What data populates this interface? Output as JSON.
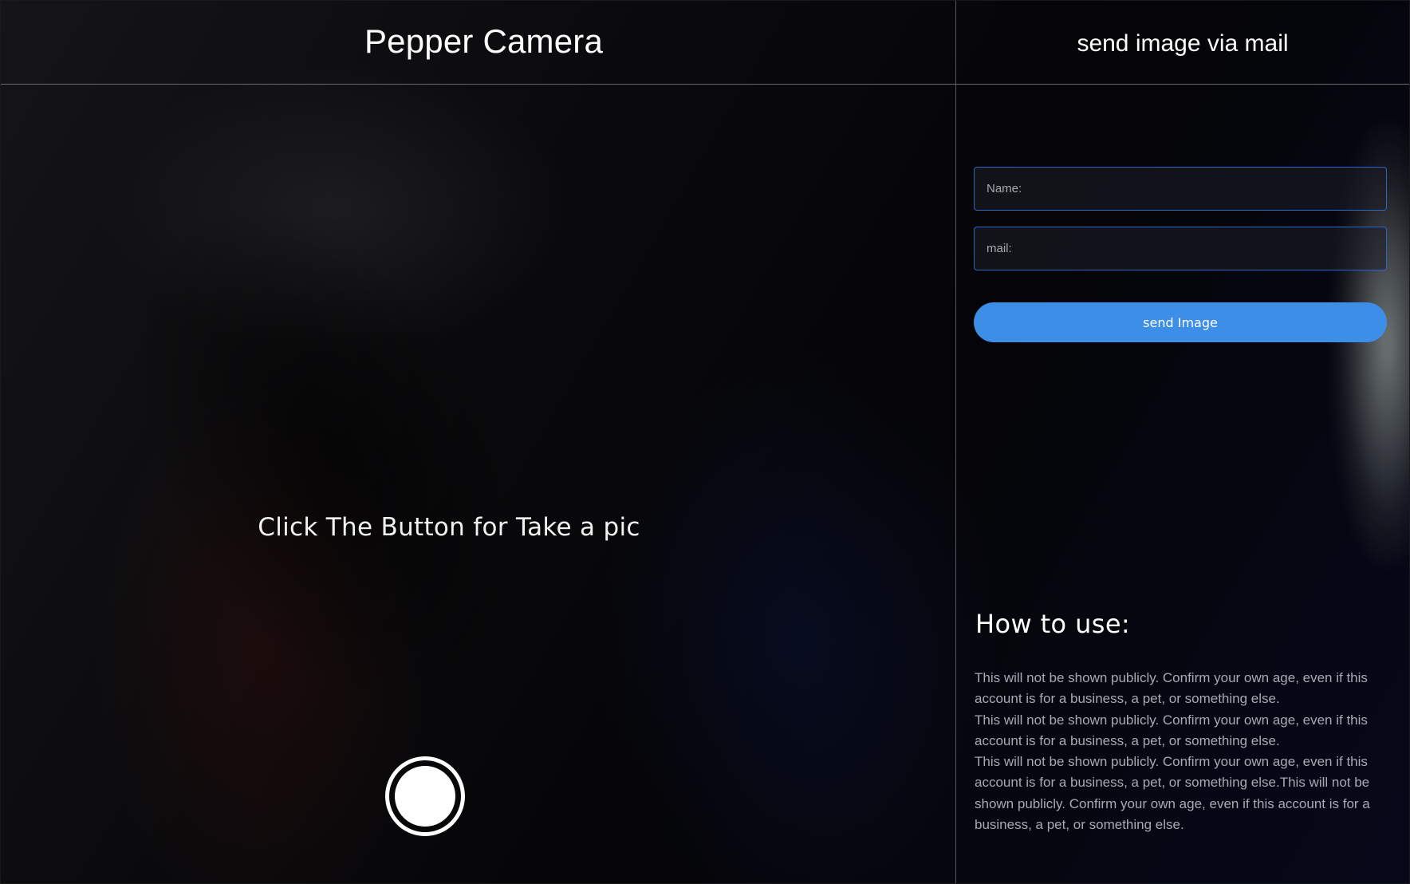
{
  "camera": {
    "title": "Pepper Camera",
    "prompt": "Click The Button for Take a pic"
  },
  "mail": {
    "title": "send image via mail",
    "name_placeholder": "Name:",
    "mail_placeholder": "mail:",
    "send_label": "send Image"
  },
  "howto": {
    "title": "How to use:",
    "paragraphs": [
      "This will not be shown publicly. Confirm your own age, even if this account is for a business, a pet, or something else.",
      "This will not be shown publicly. Confirm your own age, even if this account is for a business, a pet, or something else.",
      "This will not be shown publicly. Confirm your own age, even if this account is for a business, a pet, or something else.This will not be shown publicly. Confirm your own age, even if this account is for a business, a pet, or something else."
    ]
  },
  "colors": {
    "accent": "#3c8ee6",
    "field_border": "#2e64c8"
  }
}
